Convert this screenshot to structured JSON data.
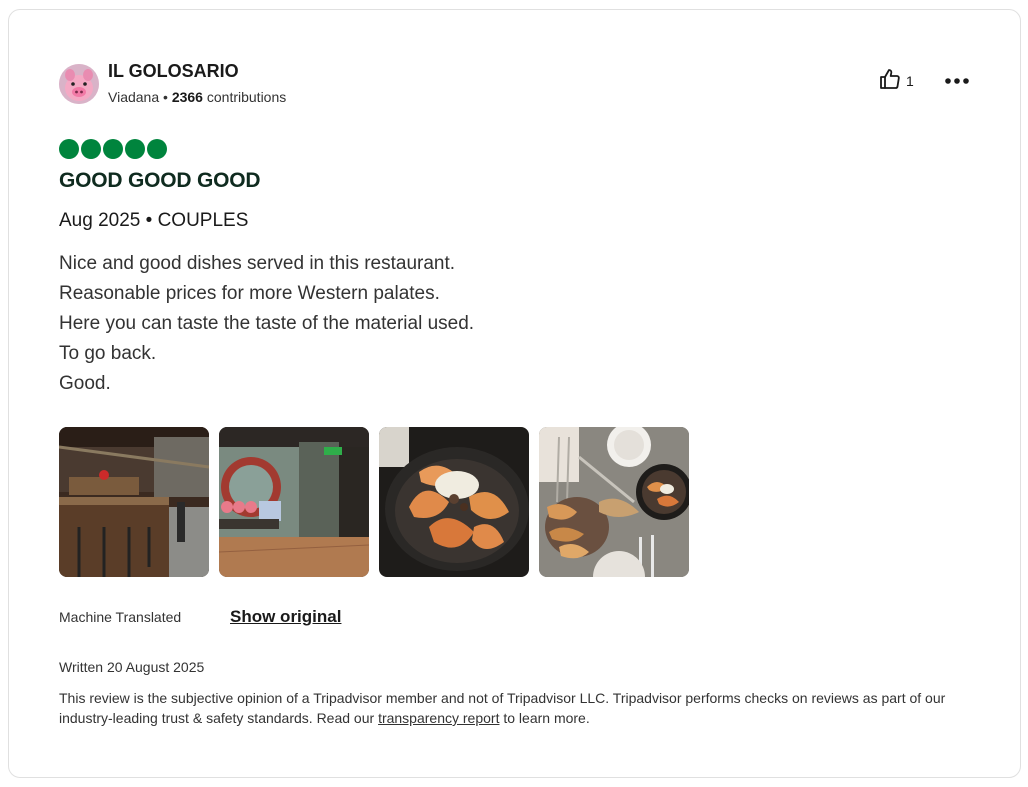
{
  "review": {
    "author": {
      "name": "IL GOLOSARIO",
      "location": "Viadana",
      "separator": " • ",
      "contributions_count": "2366",
      "contributions_label": " contributions"
    },
    "helpful_votes": "1",
    "rating": 5,
    "rating_max": 5,
    "title": "GOOD GOOD GOOD",
    "visit_info": "Aug 2025 • COUPLES",
    "body_lines": [
      "Nice and good dishes served in this restaurant.",
      "Reasonable prices for more Western palates.",
      "Here you can taste the taste of the material used.",
      "To go back.",
      "Good."
    ],
    "photo_count": 4,
    "translation_label": "Machine Translated",
    "show_original_label": "Show original",
    "written_date": "Written 20 August 2025",
    "disclaimer_before": "This review is the subjective opinion of a Tripadvisor member and not of Tripadvisor LLC. Tripadvisor performs checks on reviews as part of our industry-leading trust & safety standards. Read our ",
    "disclaimer_link": "transparency report",
    "disclaimer_after": " to learn more."
  },
  "colors": {
    "bubble_fill": "#00843d",
    "title_color": "#0f2b1f"
  },
  "icons": {
    "helpful": "thumbs-up-icon",
    "more": "more-horizontal-icon",
    "rating": "rating-bubble-icon"
  }
}
